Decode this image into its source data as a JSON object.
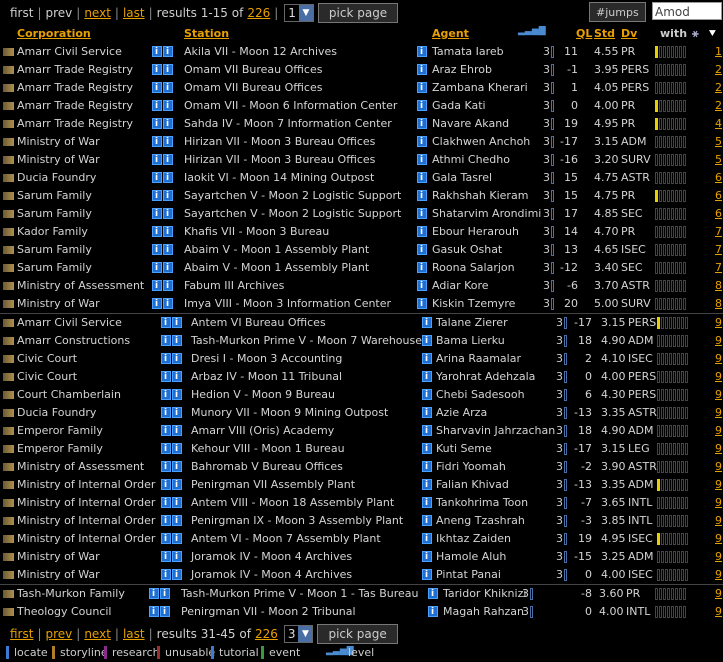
{
  "top_nav": {
    "first": "first",
    "prev": "prev",
    "next": "next",
    "last": "last",
    "results_prefix": "results 1-15 of",
    "total": "226",
    "page": "1",
    "pick_page": "pick page",
    "jumps": "#jumps",
    "jump_input": "Amod"
  },
  "headers": {
    "corporation": "Corporation",
    "station": "Station",
    "agent": "Agent",
    "ql": "QL",
    "std": "Std",
    "dv": "Dv",
    "with": "with"
  },
  "rows": [
    {
      "corp": "Amarr Civil Service",
      "station": "Akila VII - Moon 12 Archives",
      "agent": "Tamata Iareb",
      "lvl": "3",
      "ql": "11",
      "std": "4.55",
      "dv": "PR",
      "eff": 1,
      "n": "1"
    },
    {
      "corp": "Amarr Trade Registry",
      "station": "Omam VII Bureau Offices",
      "agent": "Araz Ehrob",
      "lvl": "3",
      "ql": "-1",
      "std": "3.95",
      "dv": "PERS",
      "eff": 0,
      "n": "2"
    },
    {
      "corp": "Amarr Trade Registry",
      "station": "Omam VII Bureau Offices",
      "agent": "Zambana Kherari",
      "lvl": "3",
      "ql": "1",
      "std": "4.05",
      "dv": "PERS",
      "eff": 0,
      "n": "2"
    },
    {
      "corp": "Amarr Trade Registry",
      "station": "Omam VII - Moon 6 Information Center",
      "agent": "Gada Kati",
      "lvl": "3",
      "ql": "0",
      "std": "4.00",
      "dv": "PR",
      "eff": 1,
      "n": "2"
    },
    {
      "corp": "Amarr Trade Registry",
      "station": "Sahda IV - Moon 7 Information Center",
      "agent": "Navare Akand",
      "lvl": "3",
      "ql": "19",
      "std": "4.95",
      "dv": "PR",
      "eff": 1,
      "n": "4"
    },
    {
      "corp": "Ministry of War",
      "station": "Hirizan VII - Moon 3 Bureau Offices",
      "agent": "Clakhwen Anchoh",
      "lvl": "3",
      "ql": "-17",
      "std": "3.15",
      "dv": "ADM",
      "eff": 0,
      "n": "5"
    },
    {
      "corp": "Ministry of War",
      "station": "Hirizan VII - Moon 3 Bureau Offices",
      "agent": "Athmi Chedho",
      "lvl": "3",
      "ql": "-16",
      "std": "3.20",
      "dv": "SURV",
      "eff": 0,
      "n": "5"
    },
    {
      "corp": "Ducia Foundry",
      "station": "Iaokit VI - Moon 14 Mining Outpost",
      "agent": "Gala Tasrel",
      "lvl": "3",
      "ql": "15",
      "std": "4.75",
      "dv": "ASTR",
      "eff": 0,
      "n": "6"
    },
    {
      "corp": "Sarum Family",
      "station": "Sayartchen V - Moon 2 Logistic Support",
      "agent": "Rakhshah Kieram",
      "lvl": "3",
      "ql": "15",
      "std": "4.75",
      "dv": "PR",
      "eff": 1,
      "n": "6"
    },
    {
      "corp": "Sarum Family",
      "station": "Sayartchen V - Moon 2 Logistic Support",
      "agent": "Shatarvim Arondimi",
      "lvl": "3",
      "ql": "17",
      "std": "4.85",
      "dv": "SEC",
      "eff": 0,
      "n": "6"
    },
    {
      "corp": "Kador Family",
      "station": "Khafis VII - Moon 3 Bureau",
      "agent": "Ebour Herarouh",
      "lvl": "3",
      "ql": "14",
      "std": "4.70",
      "dv": "PR",
      "eff": 0,
      "n": "7"
    },
    {
      "corp": "Sarum Family",
      "station": "Abaim V - Moon 1 Assembly Plant",
      "agent": "Gasuk Oshat",
      "lvl": "3",
      "ql": "13",
      "std": "4.65",
      "dv": "ISEC",
      "eff": 0,
      "n": "7"
    },
    {
      "corp": "Sarum Family",
      "station": "Abaim V - Moon 1 Assembly Plant",
      "agent": "Roona Salarjon",
      "lvl": "3",
      "ql": "-12",
      "std": "3.40",
      "dv": "SEC",
      "eff": 0,
      "n": "7"
    },
    {
      "corp": "Ministry of Assessment",
      "station": "Fabum III Archives",
      "agent": "Adiar Kore",
      "lvl": "3",
      "ql": "-6",
      "std": "3.70",
      "dv": "ASTR",
      "eff": 0,
      "n": "8"
    },
    {
      "corp": "Ministry of War",
      "station": "Imya VIII - Moon 3 Information Center",
      "agent": "Kiskin Tzemyre",
      "lvl": "3",
      "ql": "20",
      "std": "5.00",
      "dv": "SURV",
      "eff": 0,
      "n": "8"
    }
  ],
  "rows2": [
    {
      "corp": "Amarr Civil Service",
      "station": "Antem VI Bureau Offices",
      "agent": "Talane Zierer",
      "lvl": "3",
      "ql": "-17",
      "std": "3.15",
      "dv": "PERS",
      "eff": 1,
      "n": "9"
    },
    {
      "corp": "Amarr Constructions",
      "station": "Tash-Murkon Prime V - Moon 7 Warehouse",
      "agent": "Bama Lierku",
      "lvl": "3",
      "ql": "18",
      "std": "4.90",
      "dv": "ADM",
      "eff": 0,
      "n": "9"
    },
    {
      "corp": "Civic Court",
      "station": "Dresi I - Moon 3 Accounting",
      "agent": "Arina Raamalar",
      "lvl": "3",
      "ql": "2",
      "std": "4.10",
      "dv": "ISEC",
      "eff": 0,
      "n": "9"
    },
    {
      "corp": "Civic Court",
      "station": "Arbaz IV - Moon 11 Tribunal",
      "agent": "Yarohrat Adehzala",
      "lvl": "3",
      "ql": "0",
      "std": "4.00",
      "dv": "PERS",
      "eff": 0,
      "n": "9"
    },
    {
      "corp": "Court Chamberlain",
      "station": "Hedion V - Moon 9 Bureau",
      "agent": "Chebi Sadesooh",
      "lvl": "3",
      "ql": "6",
      "std": "4.30",
      "dv": "PERS",
      "eff": 0,
      "n": "9"
    },
    {
      "corp": "Ducia Foundry",
      "station": "Munory VII - Moon 9 Mining Outpost",
      "agent": "Azie Arza",
      "lvl": "3",
      "ql": "-13",
      "std": "3.35",
      "dv": "ASTR",
      "eff": 0,
      "n": "9"
    },
    {
      "corp": "Emperor Family",
      "station": "Amarr VIII (Oris) Academy",
      "agent": "Sharvavin Jahrzachan",
      "lvl": "3",
      "ql": "18",
      "std": "4.90",
      "dv": "ADM",
      "eff": 0,
      "n": "9"
    },
    {
      "corp": "Emperor Family",
      "station": "Kehour VIII - Moon 1 Bureau",
      "agent": "Kuti Seme",
      "lvl": "3",
      "ql": "-17",
      "std": "3.15",
      "dv": "LEG",
      "eff": 0,
      "n": "9"
    },
    {
      "corp": "Ministry of Assessment",
      "station": "Bahromab V Bureau Offices",
      "agent": "Fidri Yoomah",
      "lvl": "3",
      "ql": "-2",
      "std": "3.90",
      "dv": "ASTR",
      "eff": 0,
      "n": "9"
    },
    {
      "corp": "Ministry of Internal Order",
      "station": "Penirgman VII Assembly Plant",
      "agent": "Falian Khivad",
      "lvl": "3",
      "ql": "-13",
      "std": "3.35",
      "dv": "ADM",
      "eff": 1,
      "n": "9"
    },
    {
      "corp": "Ministry of Internal Order",
      "station": "Antem VIII - Moon 18 Assembly Plant",
      "agent": "Tankohrima Toon",
      "lvl": "3",
      "ql": "-7",
      "std": "3.65",
      "dv": "INTL",
      "eff": 0,
      "n": "9"
    },
    {
      "corp": "Ministry of Internal Order",
      "station": "Penirgman IX - Moon 3 Assembly Plant",
      "agent": "Aneng Tzashrah",
      "lvl": "3",
      "ql": "-3",
      "std": "3.85",
      "dv": "INTL",
      "eff": 0,
      "n": "9"
    },
    {
      "corp": "Ministry of Internal Order",
      "station": "Antem VI - Moon 7 Assembly Plant",
      "agent": "Ikhtaz Zaiden",
      "lvl": "3",
      "ql": "19",
      "std": "4.95",
      "dv": "ISEC",
      "eff": 1,
      "n": "9"
    },
    {
      "corp": "Ministry of War",
      "station": "Joramok IV - Moon 4 Archives",
      "agent": "Hamole Aluh",
      "lvl": "3",
      "ql": "-15",
      "std": "3.25",
      "dv": "ADM",
      "eff": 0,
      "n": "9"
    },
    {
      "corp": "Ministry of War",
      "station": "Joramok IV - Moon 4 Archives",
      "agent": "Pintat Panai",
      "lvl": "3",
      "ql": "0",
      "std": "4.00",
      "dv": "ISEC",
      "eff": 0,
      "n": "9"
    }
  ],
  "rows3": [
    {
      "corp": "Tash-Murkon Family",
      "station": "Tash-Murkon Prime V - Moon 1 - Tas Bureau",
      "agent": "Taridor Khiknizi",
      "lvl": "3",
      "ql": "-8",
      "std": "3.60",
      "dv": "PR",
      "eff": 0,
      "n": "9"
    },
    {
      "corp": "Theology Council",
      "station": "Penirgman VII - Moon 2 Tribunal",
      "agent": "Magah Rahzan",
      "lvl": "3",
      "ql": "0",
      "std": "4.00",
      "dv": "INTL",
      "eff": 0,
      "n": "9"
    }
  ],
  "bottom_nav": {
    "first": "first",
    "prev": "prev",
    "next": "next",
    "last": "last",
    "results_prefix": "results 31-45 of",
    "total": "226",
    "page": "3",
    "pick_page": "pick page"
  },
  "legend": {
    "locate": "locate",
    "storyline": "storyline",
    "research": "research",
    "unusable": "unusable",
    "tutorial": "tutorial",
    "event": "event",
    "level": "level"
  }
}
